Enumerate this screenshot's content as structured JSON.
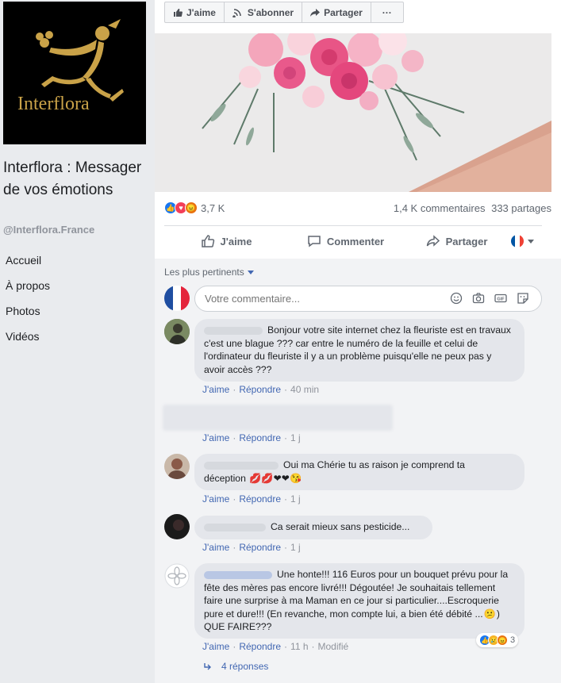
{
  "sidebar": {
    "logo_text": "Interflora",
    "page_name": "Interflora : Messager de vos émotions",
    "handle": "@Interflora.France",
    "nav": [
      "Accueil",
      "À propos",
      "Photos",
      "Vidéos"
    ]
  },
  "toolbar": {
    "like": "J'aime",
    "subscribe": "S'abonner",
    "share": "Partager",
    "more": "···"
  },
  "stats": {
    "reactions_count": "3,7 K",
    "comments": "1,4 K commentaires",
    "shares": "333 partages"
  },
  "actions": {
    "like": "J'aime",
    "comment": "Commenter",
    "share": "Partager"
  },
  "comments_section": {
    "sort_label": "Les plus pertinents",
    "input_placeholder": "Votre commentaire..."
  },
  "comments": [
    {
      "text": "Bonjour votre site internet chez la fleuriste est en travaux c'est une blague ??? car entre le numéro de la feuille et celui de l'ordinateur du fleuriste il y a un problème puisqu'elle ne peux pas y avoir accès ???",
      "like": "J'aime",
      "reply": "Répondre",
      "time": "40 min"
    },
    {
      "text": "",
      "like": "J'aime",
      "reply": "Répondre",
      "time": "1 j"
    },
    {
      "text_line1": "Oui ma Chérie tu as raison je comprend ta",
      "text_line2": "déception",
      "emojis": "💋💋❤❤😘",
      "like": "J'aime",
      "reply": "Répondre",
      "time": "1 j"
    },
    {
      "text": "Ca serait mieux sans pesticide...",
      "like": "J'aime",
      "reply": "Répondre",
      "time": "1 j"
    },
    {
      "text_part1": "Une honte!!! 116 Euros pour un bouquet prévu pour la fête des mères pas encore livré!!! Dégoutée! Je souhaitais tellement faire une surprise à ma Maman en ce jour si particulier....Escroquerie pure et dure!!! (En revanche, mon compte lui, a bien été débité ...",
      "text_part2": ") QUE FAIRE???",
      "reaction_count": "3",
      "like": "J'aime",
      "reply": "Répondre",
      "time": "11 h",
      "edited": "Modifié",
      "replies": "4 réponses"
    }
  ],
  "colors": {
    "link_blue": "#4267b2",
    "like_blue": "#1877f2",
    "love_red": "#f33e58",
    "angry_orange": "#e9710f"
  }
}
